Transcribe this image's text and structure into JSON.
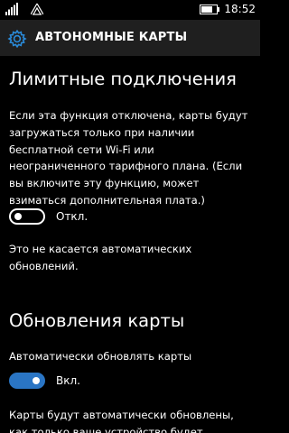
{
  "status_bar": {
    "time": "18:52",
    "icons": [
      "signal-icon",
      "wifi-icon",
      "battery-icon"
    ]
  },
  "header": {
    "title": "АВТОНОМНЫЕ КАРТЫ",
    "icon": "gear-icon"
  },
  "metered": {
    "heading": "Лимитные подключения",
    "description_lines": [
      "Если эта функция отключена, карты будут",
      "загружаться только при наличии",
      "бесплатной сети Wi-Fi или",
      "неограниченного тарифного плана. (Если",
      "вы включите эту функцию, может",
      "взиматься дополнительная плата.)"
    ],
    "toggle_state": "off",
    "toggle_label": "Откл.",
    "note_lines": [
      "Это не касается автоматических",
      "обновлений."
    ]
  },
  "updates": {
    "heading": "Обновления карты",
    "auto_update_label": "Автоматически обновлять карты",
    "toggle_state": "on",
    "toggle_label": "Вкл.",
    "description_lines": [
      "Карты будут автоматически обновлены,",
      "как только ваше устройство будет"
    ]
  },
  "colors": {
    "background": "#000000",
    "header_background": "#1f1f1f",
    "accent": "#2a75c4",
    "text": "#ffffff"
  }
}
